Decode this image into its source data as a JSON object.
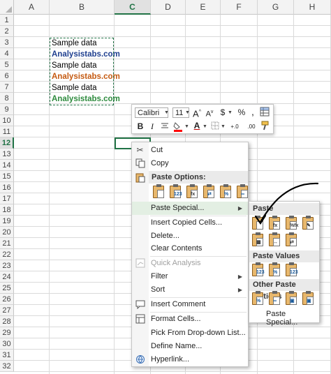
{
  "columns": [
    {
      "label": "A",
      "selected": false
    },
    {
      "label": "B",
      "selected": false
    },
    {
      "label": "C",
      "selected": true
    },
    {
      "label": "D",
      "selected": false
    },
    {
      "label": "E",
      "selected": false
    },
    {
      "label": "F",
      "selected": false
    },
    {
      "label": "G",
      "selected": false
    },
    {
      "label": "H",
      "selected": false
    }
  ],
  "rows": [
    "1",
    "2",
    "3",
    "4",
    "5",
    "6",
    "7",
    "8",
    "9",
    "10",
    "11",
    "12",
    "13",
    "14",
    "15",
    "16",
    "17",
    "18",
    "19",
    "20",
    "21",
    "22",
    "23",
    "24",
    "25",
    "26",
    "27",
    "28",
    "29",
    "30",
    "31",
    "32"
  ],
  "selected_row": "12",
  "cells": [
    {
      "text": "Sample data",
      "color": "#000000",
      "bold": false
    },
    {
      "text": "Analysistabs.com",
      "color": "#1f3f8f",
      "bold": true
    },
    {
      "text": "Sample data",
      "color": "#000000",
      "bold": false
    },
    {
      "text": "Analysistabs.com",
      "color": "#c55a11",
      "bold": true
    },
    {
      "text": "Sample data",
      "color": "#000000",
      "bold": false
    },
    {
      "text": "Analysistabs.com",
      "color": "#2e8b3e",
      "bold": true
    }
  ],
  "mini_toolbar": {
    "font": "Calibri",
    "size": "11",
    "grow": "A",
    "shrink": "A",
    "currency": "$",
    "percent": "%",
    "comma": ",",
    "bold": "B",
    "italic": "I",
    "inc_decimal": "+.0",
    "dec_decimal": ".00"
  },
  "context_menu": {
    "cut": "Cut",
    "copy": "Copy",
    "paste_options_header": "Paste Options:",
    "paste_special": "Paste Special...",
    "insert_copied_cells": "Insert Copied Cells...",
    "delete": "Delete...",
    "clear_contents": "Clear Contents",
    "quick_analysis": "Quick Analysis",
    "filter": "Filter",
    "sort": "Sort",
    "insert_comment": "Insert Comment",
    "format_cells": "Format Cells...",
    "pick_from_list": "Pick From Drop-down List...",
    "define_name": "Define Name...",
    "hyperlink": "Hyperlink..."
  },
  "paste_submenu": {
    "paste_header": "Paste",
    "paste_values_header": "Paste Values",
    "other_header": "Other Paste Options",
    "paste_special_link": "Paste Special..."
  },
  "colors": {
    "accent": "#217346",
    "highlight": "#e3efe3"
  }
}
